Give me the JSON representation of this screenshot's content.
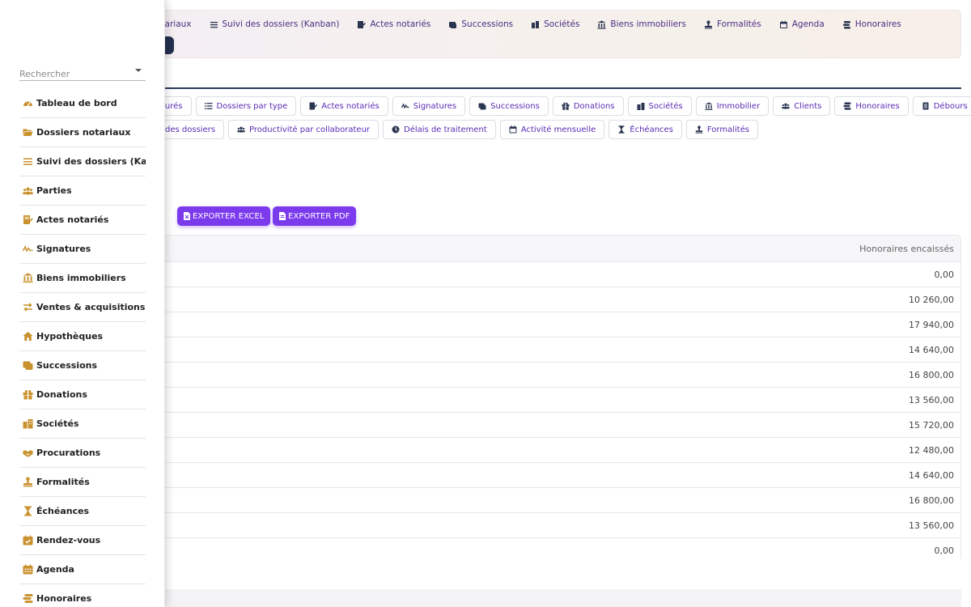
{
  "topnav": {
    "items": [
      {
        "label": "otariaux",
        "icon": "folder-icon"
      },
      {
        "label": "Suivi des dossiers (Kanban)",
        "icon": "list-icon"
      },
      {
        "label": "Actes notariés",
        "icon": "document-edit-icon"
      },
      {
        "label": "Successions",
        "icon": "scroll-icon"
      },
      {
        "label": "Sociétés",
        "icon": "building-icon"
      },
      {
        "label": "Biens immobiliers",
        "icon": "bank-icon"
      },
      {
        "label": "Formalités",
        "icon": "stamp-icon"
      },
      {
        "label": "Agenda",
        "icon": "calendar-icon"
      },
      {
        "label": "Honoraires",
        "icon": "coins-icon"
      }
    ]
  },
  "chips": {
    "row1": [
      {
        "label": "turés",
        "icon": ""
      },
      {
        "label": "Dossiers par type",
        "icon": "list-icon"
      },
      {
        "label": "Actes notariés",
        "icon": "document-edit-icon"
      },
      {
        "label": "Signatures",
        "icon": "signature-icon"
      },
      {
        "label": "Successions",
        "icon": "scroll-icon"
      },
      {
        "label": "Donations",
        "icon": "gift-icon"
      },
      {
        "label": "Sociétés",
        "icon": "building-icon"
      },
      {
        "label": "Immobilier",
        "icon": "bank-icon"
      },
      {
        "label": "Clients",
        "icon": "users-icon"
      },
      {
        "label": "Honoraires",
        "icon": "coins-icon"
      },
      {
        "label": "Débours",
        "icon": "receipt-icon"
      }
    ],
    "row2": [
      {
        "label": "des dossiers",
        "icon": ""
      },
      {
        "label": "Productivité par collaborateur",
        "icon": "users-icon"
      },
      {
        "label": "Délais de traitement",
        "icon": "clock-icon"
      },
      {
        "label": "Activité mensuelle",
        "icon": "calendar-icon"
      },
      {
        "label": "Échéances",
        "icon": "hourglass-icon"
      },
      {
        "label": "Formalités",
        "icon": "stamp-icon"
      }
    ]
  },
  "export": {
    "excel_label": "EXPORTER EXCEL",
    "pdf_label": "EXPORTER PDF"
  },
  "table": {
    "header": "Honoraires encaissés",
    "rows": [
      "0,00",
      "10 260,00",
      "17 940,00",
      "14 640,00",
      "16 800,00",
      "13 560,00",
      "15 720,00",
      "12 480,00",
      "14 640,00",
      "16 800,00",
      "13 560,00",
      "0,00"
    ]
  },
  "drawer": {
    "search_placeholder": "Rechercher",
    "items": [
      {
        "label": "Tableau de bord",
        "icon": "dashboard-icon"
      },
      {
        "label": "Dossiers notariaux",
        "icon": "folder-open-icon"
      },
      {
        "label": "Suivi des dossiers (Kanba",
        "icon": "list-icon"
      },
      {
        "label": "Parties",
        "icon": "users-icon"
      },
      {
        "label": "Actes notariés",
        "icon": "document-edit-icon"
      },
      {
        "label": "Signatures",
        "icon": "signature-icon"
      },
      {
        "label": "Biens immobiliers",
        "icon": "bank-icon"
      },
      {
        "label": "Ventes & acquisitions",
        "icon": "exchange-icon"
      },
      {
        "label": "Hypothèques",
        "icon": "house-icon"
      },
      {
        "label": "Successions",
        "icon": "scroll-icon"
      },
      {
        "label": "Donations",
        "icon": "gift-icon"
      },
      {
        "label": "Sociétés",
        "icon": "building-icon"
      },
      {
        "label": "Procurations",
        "icon": "handshake-icon"
      },
      {
        "label": "Formalités",
        "icon": "stamp-icon"
      },
      {
        "label": "Échéances",
        "icon": "hourglass-icon"
      },
      {
        "label": "Rendez-vous",
        "icon": "calendar-check-icon"
      },
      {
        "label": "Agenda",
        "icon": "calendar-icon"
      },
      {
        "label": "Honoraires",
        "icon": "coins-icon"
      }
    ]
  },
  "colors": {
    "accent": "#7c3aed",
    "link": "#5b2bb5",
    "drawer_icon": "#c9922e",
    "nav_dark": "#23304e"
  }
}
